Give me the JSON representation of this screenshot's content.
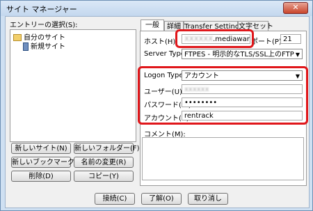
{
  "window": {
    "title": "サイト マネージャー",
    "close_label": "✕"
  },
  "left": {
    "tree_label": "エントリーの選択(S):",
    "tree": [
      {
        "label": "自分のサイト",
        "icon": "folder-icon"
      },
      {
        "label": "新規サイト",
        "icon": "site-icon"
      }
    ],
    "buttons": {
      "new_site": "新しいサイト(N)",
      "new_folder": "新しいフォルダー(F)",
      "new_bookmark": "新しいブックマーク(M)",
      "rename": "名前の変更(R)",
      "delete": "削除(D)",
      "copy": "コピー(Y)"
    }
  },
  "tabs": [
    {
      "label": "一般",
      "active": true
    },
    {
      "label": "詳細",
      "active": false
    },
    {
      "label": "Transfer Settings",
      "active": false
    },
    {
      "label": "文字セット",
      "active": false
    }
  ],
  "general": {
    "host_label": "ホスト(H):",
    "host_value_masked": "XXXXXX",
    "host_value": ".mediawars.net",
    "port_label": "ポート(P):",
    "port_value": "21",
    "server_type_label": "Server Type:",
    "server_type_value": "FTPES - 明示的なTLS/SSL上のFTP",
    "logon_type_label": "Logon Type:",
    "logon_type_value": "アカウント",
    "user_label": "ユーザー(U):",
    "user_value_masked": "xxxxxx",
    "password_label": "パスワード(W):",
    "password_value": "••••••••",
    "account_label": "アカウント(A):",
    "account_value": "rentrack",
    "comment_label": "コメント(M):"
  },
  "footer": {
    "connect": "接続(C)",
    "ok": "了解(O)",
    "cancel": "取り消し"
  },
  "colors": {
    "highlight": "#e0161a",
    "titlebar": "#c3d7ee"
  }
}
